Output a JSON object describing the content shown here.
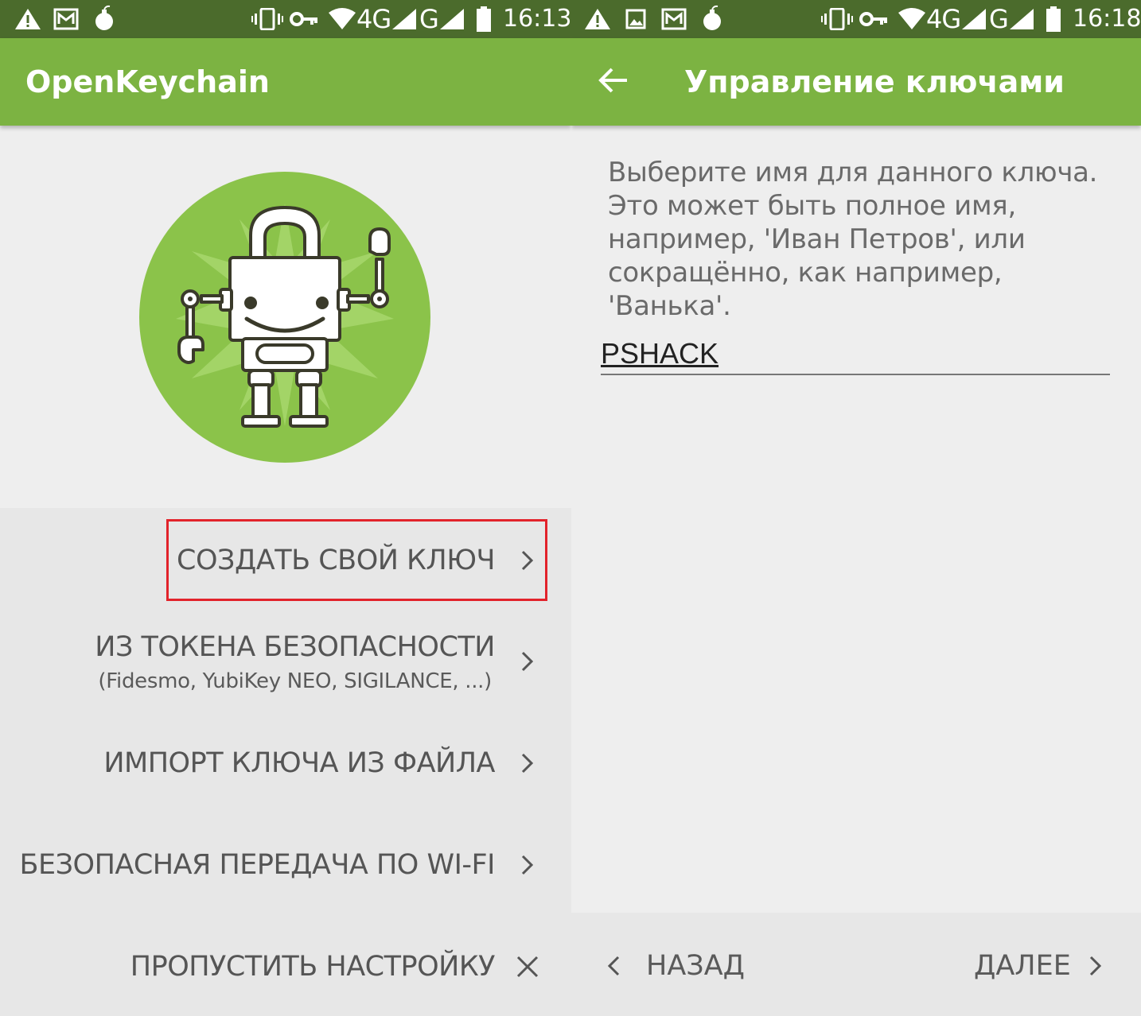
{
  "left_screen": {
    "status_bar": {
      "icons_left": [
        "warning-icon",
        "email-icon",
        "bomb-icon"
      ],
      "icons_right": [
        "vibrate-icon",
        "vpn-key-icon",
        "wifi-icon",
        "signal-icon",
        "signal-icon",
        "battery-icon"
      ],
      "network_1": "4G",
      "network_2": "G",
      "time": "16:13"
    },
    "app_bar": {
      "title": "OpenKeychain"
    },
    "logo": {
      "icon": "robot-padlock-icon"
    },
    "menu": {
      "items": [
        {
          "label": "СОЗДАТЬ СВОЙ КЛЮЧ",
          "icon": "chevron-right-icon",
          "highlighted": true,
          "highlight_color": "#e2232b"
        },
        {
          "label": "ИЗ ТОКЕНА БЕЗОПАСНОСТИ",
          "sublabel": "(Fidesmo, YubiKey NEO, SIGILANCE, ...)",
          "icon": "chevron-right-icon"
        },
        {
          "label": "ИМПОРТ КЛЮЧА ИЗ ФАЙЛА",
          "icon": "chevron-right-icon"
        },
        {
          "label": "БЕЗОПАСНАЯ ПЕРЕДАЧА ПО WI-FI",
          "icon": "chevron-right-icon"
        },
        {
          "label": "ПРОПУСТИТЬ НАСТРОЙКУ",
          "icon": "close-icon"
        }
      ]
    }
  },
  "right_screen": {
    "status_bar": {
      "icons_left": [
        "warning-icon",
        "image-icon",
        "email-icon",
        "bomb-icon"
      ],
      "icons_right": [
        "vibrate-icon",
        "vpn-key-icon",
        "wifi-icon",
        "signal-icon",
        "signal-icon",
        "battery-icon"
      ],
      "network_1": "4G",
      "network_2": "G",
      "time": "16:18"
    },
    "app_bar": {
      "back_icon": "arrow-back-icon",
      "title": "Управление ключами"
    },
    "description": "Выберите имя для данного ключа. Это может быть полное имя, например, 'Иван Петров', или сокращённо, как например, 'Ванька'.",
    "name_field": {
      "value": "PSHACK"
    },
    "bottom_nav": {
      "back_label": "НАЗАД",
      "back_icon": "chevron-left-icon",
      "next_label": "ДАЛЕЕ",
      "next_icon": "chevron-right-icon"
    }
  },
  "colors": {
    "status_bar": "#4b6b2c",
    "app_bar": "#7cb342",
    "logo_circle": "#8bc34a",
    "highlight": "#e2232b",
    "background": "#eeeeee",
    "menu_background": "#e7e7e7",
    "text": "#555555"
  }
}
